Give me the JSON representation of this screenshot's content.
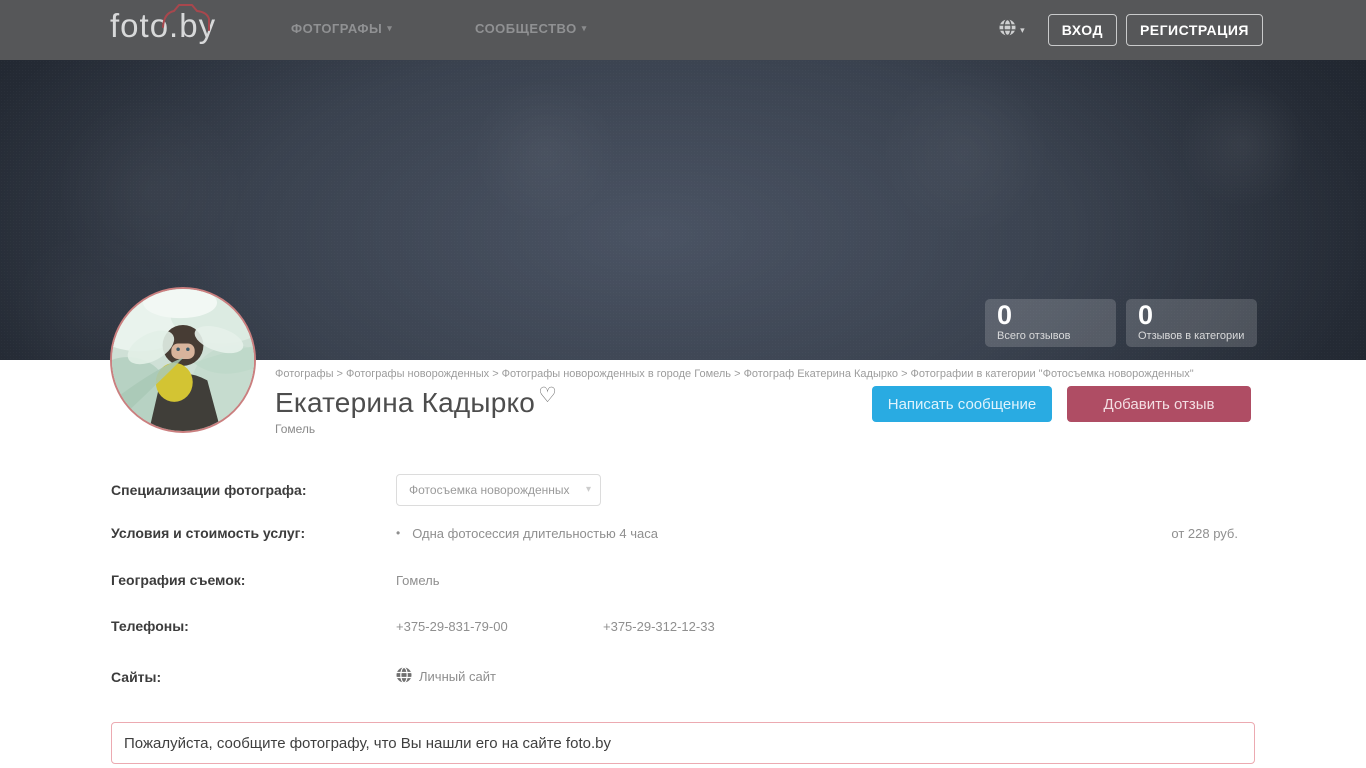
{
  "navbar": {
    "logo": "foto.by",
    "menu": [
      {
        "label": "ФОТОГРАФЫ"
      },
      {
        "label": "СООБЩЕСТВО"
      }
    ],
    "login_label": "ВХОД",
    "register_label": "РЕГИСТРАЦИЯ"
  },
  "hero": {
    "stats": [
      {
        "value": "0",
        "label": "Всего отзывов"
      },
      {
        "value": "0",
        "label": "Отзывов в категории"
      }
    ]
  },
  "profile": {
    "breadcrumb": "Фотографы > Фотографы новорожденных > Фотографы новорожденных в городе Гомель > Фотограф Екатерина Кадырко > Фотографии в категории \"Фотосъемка новорожденных\"",
    "name": "Екатерина Кадырко",
    "city": "Гомель",
    "message_button": "Написать сообщение",
    "review_button": "Добавить отзыв"
  },
  "details": {
    "specializations_label": "Специализации фотографа:",
    "specialization_selected": "Фотосъемка новорожденных",
    "pricing_label": "Условия и стоимость услуг:",
    "pricing_item": "Одна фотосессия длительностью 4 часа",
    "pricing_price": "от 228 руб.",
    "geography_label": "География съемок:",
    "geography_value": "Гомель",
    "phones_label": "Телефоны:",
    "phones": [
      "+375-29-831-79-00",
      "+375-29-312-12-33"
    ],
    "sites_label": "Сайты:",
    "site_link": "Личный сайт"
  },
  "notice": "Пожалуйста, сообщите фотографу, что Вы нашли его на сайте foto.by",
  "icons": {
    "favorite_heart": "♡",
    "dropdown_caret": "▾",
    "bullet": "•"
  },
  "colors": {
    "navbar_bg": "#565759",
    "accent_blue": "#29abe2",
    "accent_maroon": "#af4d64",
    "logo_camera_red": "#a8474d",
    "notice_border": "#ecaab1",
    "avatar_border": "#ca7f7f"
  }
}
